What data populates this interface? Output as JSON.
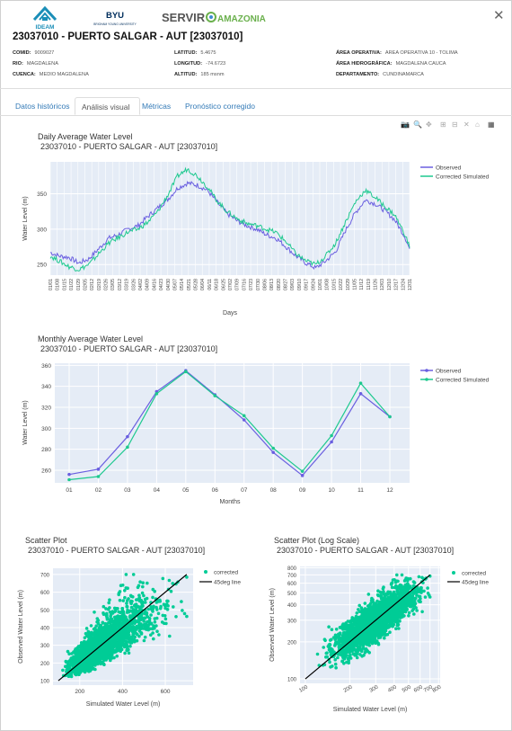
{
  "header": {
    "logos": {
      "ideam": "IDEAM",
      "byu": "BYU",
      "byu_sub": "BRIGHAM YOUNG UNIVERSITY",
      "servir": "SERVIR",
      "amazonia": "AMAZONIA"
    },
    "close_icon": "close-icon",
    "station_title": "23037010 - PUERTO SALGAR - AUT [23037010]"
  },
  "station_info": {
    "comid_label": "COMID:",
    "comid_value": "9009027",
    "rio_label": "RIO:",
    "rio_value": "MAGDALENA",
    "cuenca_label": "CUENCA:",
    "cuenca_value": "MEDIO MAGDALENA",
    "latitud_label": "LATITUD:",
    "latitud_value": "5.4675",
    "longitud_label": "LONGITUD:",
    "longitud_value": "-74.6723",
    "altitud_label": "ALTITUD:",
    "altitud_value": "185 msnm",
    "area_operativa_label": "ÁREA OPERATIVA:",
    "area_operativa_value": "AREA OPERATIVA 10 - TOLIMA",
    "area_hidro_label": "ÁREA HIDROGRÁFICA:",
    "area_hidro_value": "MAGDALENA CAUCA",
    "departamento_label": "DEPARTAMENTO:",
    "departamento_value": "CUNDINAMARCA"
  },
  "tabs": [
    {
      "label": "Datos históricos"
    },
    {
      "label": "Análisis visual"
    },
    {
      "label": "Métricas"
    },
    {
      "label": "Pronóstico corregido"
    }
  ],
  "modebar_icons": [
    "camera-icon",
    "zoom-icon",
    "pan-icon",
    "zoom-in-icon",
    "zoom-out-icon",
    "autoscale-icon",
    "home-icon",
    "plotly-logo-icon"
  ],
  "colors": {
    "observed": "#6a5fe0",
    "corrected": "#1ec98f",
    "plot_bg": "#e5ecf6",
    "scatter": "#00cc96",
    "link": "#337ab7"
  },
  "chart_data": [
    {
      "type": "line",
      "title": "Daily Average Water Level",
      "subtitle": "23037010 - PUERTO SALGAR - AUT [23037010]",
      "xlabel": "Days",
      "ylabel": "Water Level (m)",
      "ylim": [
        235,
        395
      ],
      "yticks": [
        250,
        300,
        350
      ],
      "x_ticks": [
        "01/01",
        "01/08",
        "01/15",
        "01/22",
        "01/29",
        "02/05",
        "02/12",
        "02/19",
        "02/26",
        "03/05",
        "03/12",
        "03/19",
        "03/26",
        "04/02",
        "04/09",
        "04/16",
        "04/23",
        "04/30",
        "05/07",
        "05/14",
        "05/21",
        "05/28",
        "06/04",
        "06/11",
        "06/18",
        "06/25",
        "07/02",
        "07/09",
        "07/16",
        "07/23",
        "07/30",
        "08/06",
        "08/13",
        "08/20",
        "08/27",
        "09/03",
        "09/10",
        "09/17",
        "09/24",
        "10/01",
        "10/08",
        "10/15",
        "10/22",
        "10/29",
        "11/05",
        "11/12",
        "11/19",
        "11/26",
        "12/03",
        "12/10",
        "12/17",
        "12/24",
        "12/31"
      ],
      "legend_position": "top-right",
      "series": [
        {
          "name": "Observed",
          "days": [
            1,
            10,
            20,
            30,
            40,
            50,
            60,
            70,
            80,
            90,
            100,
            110,
            120,
            130,
            140,
            150,
            160,
            170,
            180,
            190,
            200,
            210,
            220,
            230,
            240,
            250,
            260,
            270,
            280,
            290,
            300,
            310,
            320,
            330,
            340,
            350,
            360,
            365
          ],
          "values": [
            267,
            262,
            260,
            252,
            258,
            272,
            287,
            292,
            300,
            305,
            318,
            330,
            342,
            358,
            365,
            362,
            355,
            338,
            322,
            312,
            305,
            300,
            292,
            287,
            275,
            262,
            252,
            245,
            255,
            268,
            298,
            323,
            341,
            336,
            326,
            313,
            290,
            272
          ]
        },
        {
          "name": "Corrected Simulated",
          "days": [
            1,
            10,
            20,
            30,
            40,
            50,
            60,
            70,
            80,
            90,
            100,
            110,
            120,
            130,
            140,
            150,
            160,
            170,
            180,
            190,
            200,
            210,
            220,
            230,
            240,
            250,
            260,
            270,
            280,
            290,
            300,
            310,
            320,
            330,
            340,
            350,
            360,
            365
          ],
          "values": [
            262,
            255,
            247,
            243,
            250,
            265,
            280,
            288,
            296,
            300,
            310,
            325,
            348,
            375,
            385,
            375,
            360,
            340,
            325,
            315,
            308,
            305,
            300,
            295,
            282,
            265,
            255,
            250,
            262,
            280,
            310,
            338,
            355,
            345,
            332,
            320,
            293,
            275
          ]
        }
      ]
    },
    {
      "type": "line",
      "title": "Monthly Average Water Level",
      "subtitle": "23037010 - PUERTO SALGAR - AUT [23037010]",
      "xlabel": "Months",
      "ylabel": "Water Level (m)",
      "ylim": [
        248,
        362
      ],
      "yticks": [
        260,
        280,
        300,
        320,
        340,
        360
      ],
      "categories": [
        "01",
        "02",
        "03",
        "04",
        "05",
        "06",
        "07",
        "08",
        "09",
        "10",
        "11",
        "12"
      ],
      "legend_position": "top-right",
      "series": [
        {
          "name": "Observed",
          "values": [
            256,
            261,
            292,
            335,
            355,
            332,
            308,
            277,
            255,
            287,
            333,
            311
          ]
        },
        {
          "name": "Corrected Simulated",
          "values": [
            251,
            254,
            282,
            333,
            354,
            331,
            312,
            281,
            259,
            293,
            343,
            311
          ]
        }
      ]
    },
    {
      "type": "scatter",
      "title": "Scatter Plot",
      "subtitle": "23037010 - PUERTO SALGAR - AUT [23037010]",
      "xlabel": "Simulated Water Level (m)",
      "ylabel": "Observed Water Level (m)",
      "xlim": [
        75,
        730
      ],
      "ylim": [
        75,
        735
      ],
      "xticks": [
        200,
        400,
        600
      ],
      "yticks": [
        100,
        200,
        300,
        400,
        500,
        600,
        700
      ],
      "legend_position": "top-right",
      "series": [
        {
          "name": "corrected",
          "center_x": 300,
          "center_y": 300,
          "min": 100,
          "max": 700,
          "n": 2200
        },
        {
          "name": "45deg line",
          "x": [
            100,
            700
          ],
          "y": [
            100,
            700
          ]
        }
      ]
    },
    {
      "type": "scatter",
      "title": "Scatter Plot (Log Scale)",
      "subtitle": "23037010 - PUERTO SALGAR - AUT [23037010]",
      "xlabel": "Simulated Water Level (m)",
      "ylabel": "Observed Water Level (m)",
      "log_scale": true,
      "xlim": [
        92,
        820
      ],
      "ylim": [
        92,
        820
      ],
      "xticks": [
        100,
        200,
        300,
        400,
        500,
        600,
        700,
        800
      ],
      "yticks": [
        100,
        200,
        300,
        400,
        500,
        600,
        700,
        800
      ],
      "legend_position": "top-right",
      "series": [
        {
          "name": "corrected",
          "center_x": 300,
          "center_y": 300,
          "min": 100,
          "max": 700,
          "n": 2200
        },
        {
          "name": "45deg line",
          "x": [
            100,
            700
          ],
          "y": [
            100,
            700
          ]
        }
      ]
    }
  ]
}
